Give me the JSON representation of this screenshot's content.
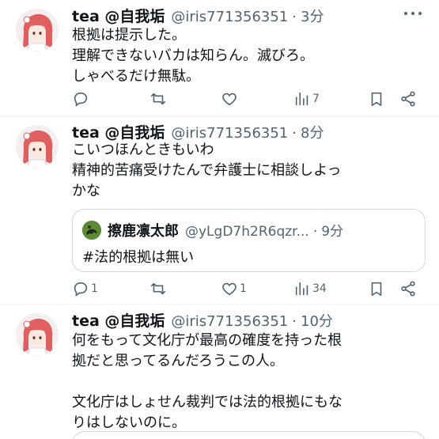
{
  "tweets": [
    {
      "name": "tea @自我垢",
      "handle": "@iris771356351",
      "separator": "·",
      "time": "3分",
      "lines": [
        "根拠は提示した。",
        "理解できないバカは知らん。滅びろ。",
        "しゃべるだけ無駄。"
      ],
      "reply_count": "",
      "retweet_count": "",
      "like_count": "",
      "view_count": "7"
    },
    {
      "name": "tea @自我垢",
      "handle": "@iris771356351",
      "separator": "·",
      "time": "8分",
      "lines": [
        "こいつほんときもいわ",
        "精神的苦痛受けたんで弁護士に相談しよっ",
        "かな"
      ],
      "quote": {
        "name": "擦鹿凛太郎",
        "handle": "@yLgD7h2R6qzr...",
        "separator": "·",
        "time": "9分",
        "text": "#法的根拠は無い"
      },
      "reply_count": "1",
      "retweet_count": "",
      "like_count": "1",
      "view_count": "34"
    },
    {
      "name": "tea @自我垢",
      "handle": "@iris771356351",
      "separator": "·",
      "time": "10分",
      "lines": [
        "何をもって文化庁が最高の確度を持った根",
        "拠だと思ってるんだろうこの人。",
        "",
        "文化庁はしょせん裁判では法的根拠にもな",
        "りはしないのに。"
      ]
    }
  ],
  "icons": {
    "reply": "reply-icon",
    "retweet": "retweet-icon",
    "like": "like-icon",
    "views": "views-icon",
    "bookmark": "bookmark-icon",
    "share": "share-icon",
    "more": "more-icon"
  },
  "colors": {
    "text": "#0f1419",
    "secondary": "#536471",
    "border": "#cfd9de",
    "avatar_hair": "#e05a5a"
  }
}
